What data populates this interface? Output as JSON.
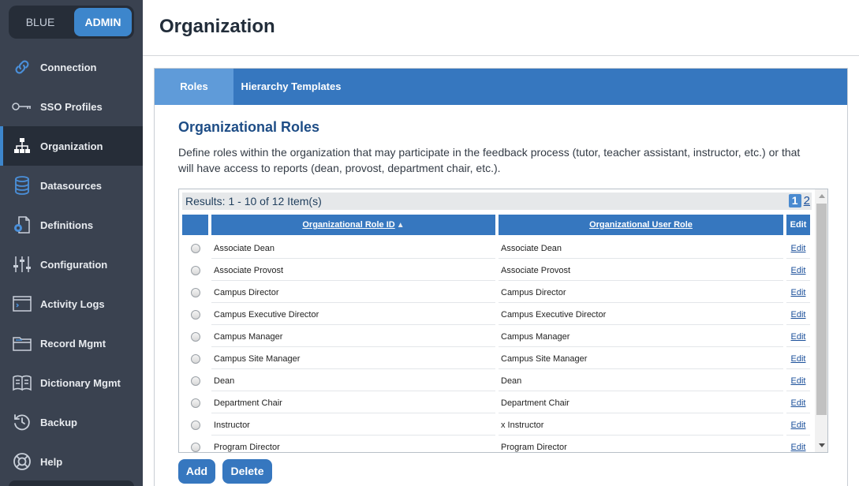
{
  "sidebar": {
    "mode_blue": "BLUE",
    "mode_admin": "ADMIN",
    "items": [
      {
        "label": "Connection",
        "icon": "link-icon"
      },
      {
        "label": "SSO Profiles",
        "icon": "key-icon"
      },
      {
        "label": "Organization",
        "icon": "org-chart-icon"
      },
      {
        "label": "Datasources",
        "icon": "database-icon"
      },
      {
        "label": "Definitions",
        "icon": "document-gear-icon"
      },
      {
        "label": "Configuration",
        "icon": "sliders-icon"
      },
      {
        "label": "Activity Logs",
        "icon": "log-window-icon"
      },
      {
        "label": "Record Mgmt",
        "icon": "folder-icon"
      },
      {
        "label": "Dictionary Mgmt",
        "icon": "book-icon"
      },
      {
        "label": "Backup",
        "icon": "history-icon"
      },
      {
        "label": "Help",
        "icon": "lifebuoy-icon"
      }
    ],
    "active_item": "Organization"
  },
  "header": {
    "title": "Organization"
  },
  "tabs": [
    {
      "label": "Roles",
      "active": true
    },
    {
      "label": "Hierarchy Templates",
      "active": false
    }
  ],
  "section": {
    "title": "Organizational Roles",
    "description": "Define roles within the organization that may participate in the feedback process (tutor, teacher assistant, instructor, etc.) or that will have access to reports (dean, provost, department chair, etc.)."
  },
  "grid": {
    "results": "Results: 1 - 10 of 12 Item(s)",
    "pages": [
      "1",
      "2"
    ],
    "current_page": "1",
    "columns": [
      "Organizational Role ID",
      "Organizational User Role",
      "Edit"
    ],
    "sort_indicator": "▲",
    "rows": [
      {
        "id": "Associate Dean",
        "role": "Associate Dean",
        "edit": "Edit"
      },
      {
        "id": "Associate Provost",
        "role": "Associate Provost",
        "edit": "Edit"
      },
      {
        "id": "Campus Director",
        "role": "Campus Director",
        "edit": "Edit"
      },
      {
        "id": "Campus Executive Director",
        "role": "Campus Executive Director",
        "edit": "Edit"
      },
      {
        "id": "Campus Manager",
        "role": "Campus Manager",
        "edit": "Edit"
      },
      {
        "id": "Campus Site Manager",
        "role": "Campus Site Manager",
        "edit": "Edit"
      },
      {
        "id": "Dean",
        "role": "Dean",
        "edit": "Edit"
      },
      {
        "id": "Department Chair",
        "role": "Department Chair",
        "edit": "Edit"
      },
      {
        "id": "Instructor",
        "role": "x Instructor",
        "edit": "Edit"
      },
      {
        "id": "Program Director",
        "role": "Program Director",
        "edit": "Edit"
      }
    ]
  },
  "buttons": {
    "add": "Add",
    "delete": "Delete"
  },
  "colors": {
    "sidebar_bg": "#3a4250",
    "sidebar_active": "#262d38",
    "accent": "#3677bf",
    "active_tab": "#5f9bd9",
    "title_blue": "#1e4d86"
  }
}
